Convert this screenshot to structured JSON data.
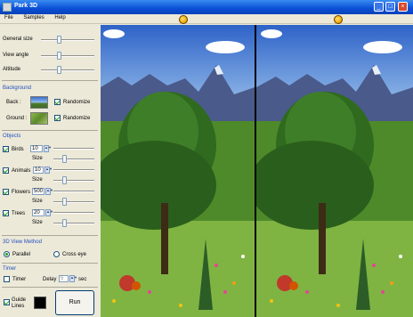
{
  "window": {
    "title": "Park 3D",
    "minimize": "_",
    "maximize": "□",
    "close": "×"
  },
  "menu": [
    "File",
    "Samples",
    "Help"
  ],
  "panel": {
    "general_size": "General size",
    "view_angle": "View angle",
    "altitude": "Altitude",
    "background_title": "Background",
    "back_label": "Back :",
    "ground_label": "Ground :",
    "randomize": "Randomize",
    "objects_title": "Objects",
    "birds": "Birds",
    "birds_count": "10",
    "animals": "Animals",
    "animals_count": "10",
    "flowers": "Flowers",
    "flowers_count": "500",
    "trees": "Trees",
    "trees_count": "20",
    "size": "Size",
    "view_method_title": "3D View Method",
    "parallel": "Parallel",
    "cross_eye": "Cross eye",
    "timer_title": "Timer",
    "timer": "Timer",
    "delay": "Delay",
    "delay_value": "5",
    "sec": "sec",
    "guide_lines_1": "Guide",
    "guide_lines_2": "Lines",
    "run": "Run"
  },
  "state": {
    "birds_checked": true,
    "animals_checked": true,
    "flowers_checked": true,
    "trees_checked": true,
    "back_randomize": true,
    "ground_randomize": true,
    "view_method": "parallel",
    "timer_checked": false,
    "guide_lines_checked": true,
    "guide_color": "#000000"
  },
  "colors": {
    "sky_top": "#2e63c8",
    "sky_bottom": "#9cc4ec",
    "grass": "#6fa83b",
    "accent": "#2550c0"
  }
}
